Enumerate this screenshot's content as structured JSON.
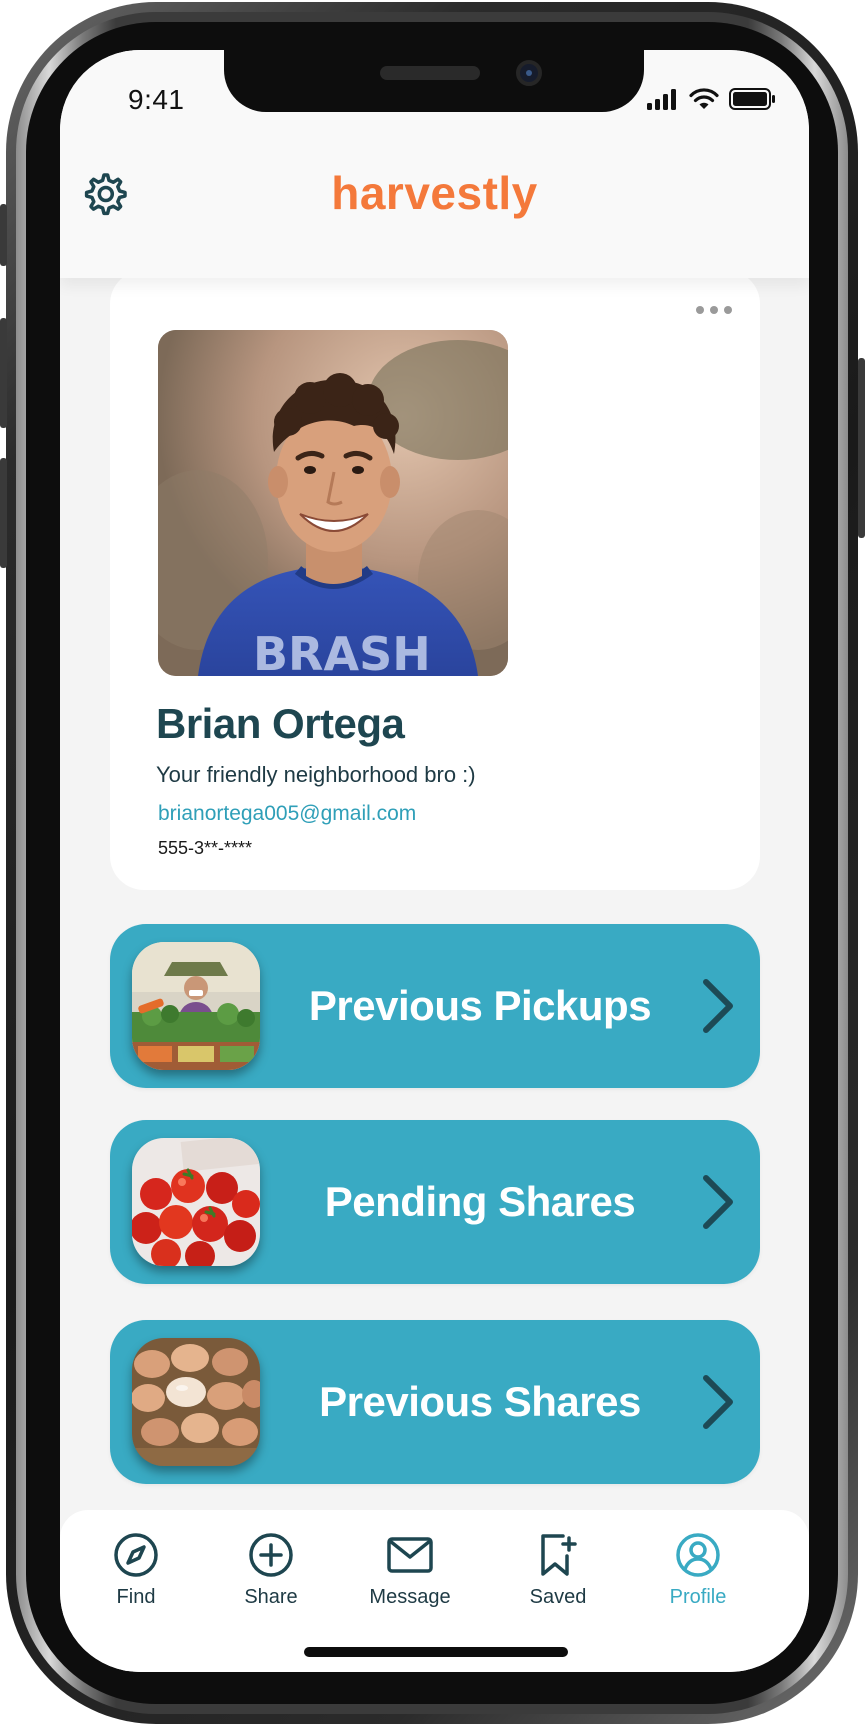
{
  "status_bar": {
    "time": "9:41"
  },
  "header": {
    "brand": "harvestly"
  },
  "profile": {
    "name": "Brian Ortega",
    "bio": "Your friendly neighborhood bro :)",
    "email": "brianortega005@gmail.com",
    "phone": "555-3**-****"
  },
  "actions": [
    {
      "label": "Previous Pickups"
    },
    {
      "label": "Pending Shares"
    },
    {
      "label": "Previous Shares"
    }
  ],
  "tabs": [
    {
      "label": "Find"
    },
    {
      "label": "Share"
    },
    {
      "label": "Message"
    },
    {
      "label": "Saved"
    },
    {
      "label": "Profile",
      "active": true
    }
  ],
  "colors": {
    "brand": "#f4793b",
    "accent": "#39aac3",
    "text_dark": "#1e4650",
    "background": "#f4f4f4"
  },
  "icons": {
    "settings": "gear-icon",
    "more": "more-horizontal-icon",
    "find": "compass-icon",
    "share": "plus-circle-icon",
    "message": "mail-icon",
    "saved": "bookmark-plus-icon",
    "profile": "user-circle-icon"
  }
}
